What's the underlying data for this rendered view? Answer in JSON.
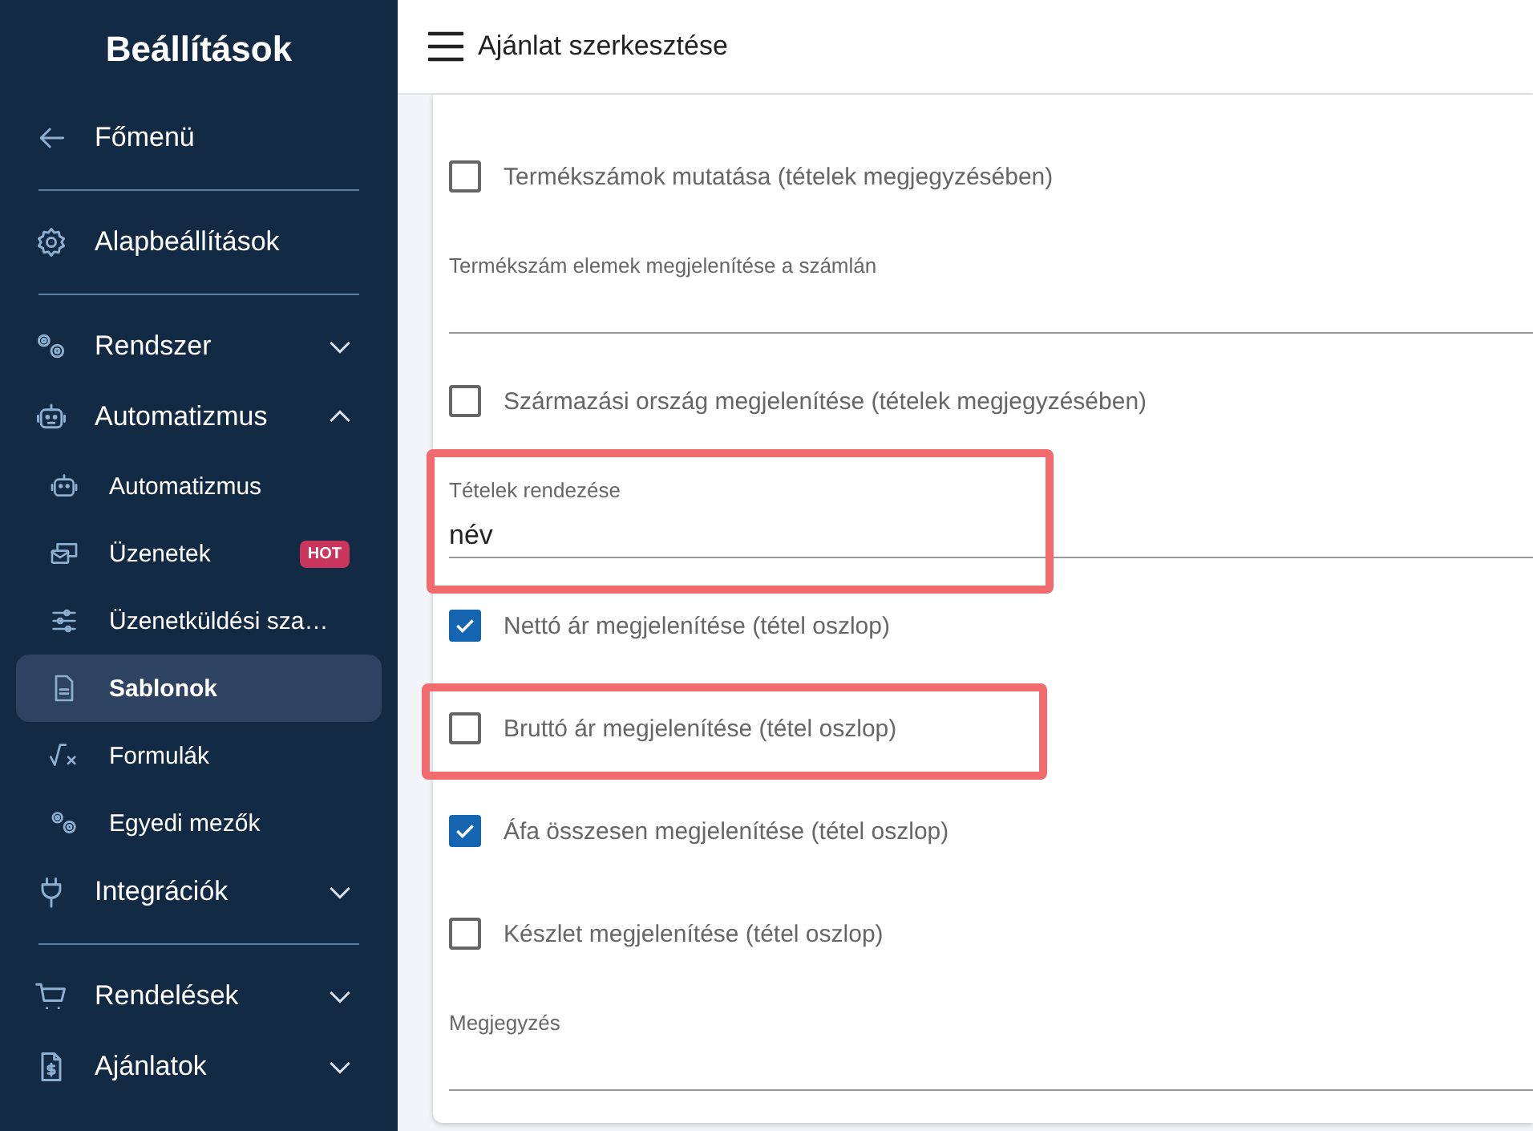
{
  "sidebar": {
    "title": "Beállítások",
    "items": [
      {
        "label": "Főmenü",
        "kind": "link",
        "divider_after": true
      },
      {
        "label": "Alapbeállítások",
        "kind": "link",
        "divider_after": true
      },
      {
        "label": "Rendszer",
        "kind": "group",
        "expanded": false,
        "divider_after": false
      },
      {
        "label": "Automatizmus",
        "kind": "group",
        "expanded": true,
        "divider_after": false,
        "children": [
          {
            "label": "Automatizmus",
            "selected": false
          },
          {
            "label": "Üzenetek",
            "selected": false,
            "badge": "HOT"
          },
          {
            "label": "Üzenetküldési sza…",
            "selected": false
          },
          {
            "label": "Sablonok",
            "selected": true
          },
          {
            "label": "Formulák",
            "selected": false
          },
          {
            "label": "Egyedi mezők",
            "selected": false
          }
        ]
      },
      {
        "label": "Integrációk",
        "kind": "group",
        "expanded": false,
        "divider_after": true
      },
      {
        "label": "Rendelések",
        "kind": "group",
        "expanded": false,
        "divider_after": false
      },
      {
        "label": "Ajánlatok",
        "kind": "group",
        "expanded": false,
        "divider_after": false
      }
    ]
  },
  "header": {
    "title": "Ajánlat szerkesztése"
  },
  "form": [
    {
      "kind": "checkbox",
      "label": "Termékszámok mutatása (tételek megjegyzésében)",
      "checked": false,
      "highlighted": false
    },
    {
      "kind": "text",
      "label": "Termékszám elemek megjelenítése a számlán",
      "highlighted": false
    },
    {
      "kind": "checkbox",
      "label": "Származási ország megjelenítése (tételek megjegyzésében)",
      "checked": false,
      "highlighted": false
    },
    {
      "kind": "select",
      "label": "Tételek rendezése",
      "value": "név",
      "highlighted": true
    },
    {
      "kind": "checkbox",
      "label": "Nettó ár megjelenítése (tétel oszlop)",
      "checked": true,
      "highlighted": false
    },
    {
      "kind": "checkbox",
      "label": "Bruttó ár megjelenítése (tétel oszlop)",
      "checked": false,
      "highlighted": true
    },
    {
      "kind": "checkbox",
      "label": "Áfa összesen megjelenítése (tétel oszlop)",
      "checked": true,
      "highlighted": false
    },
    {
      "kind": "checkbox",
      "label": "Készlet megjelenítése (tétel oszlop)",
      "checked": false,
      "highlighted": false
    },
    {
      "kind": "text",
      "label": "Megjegyzés",
      "highlighted": false
    }
  ]
}
